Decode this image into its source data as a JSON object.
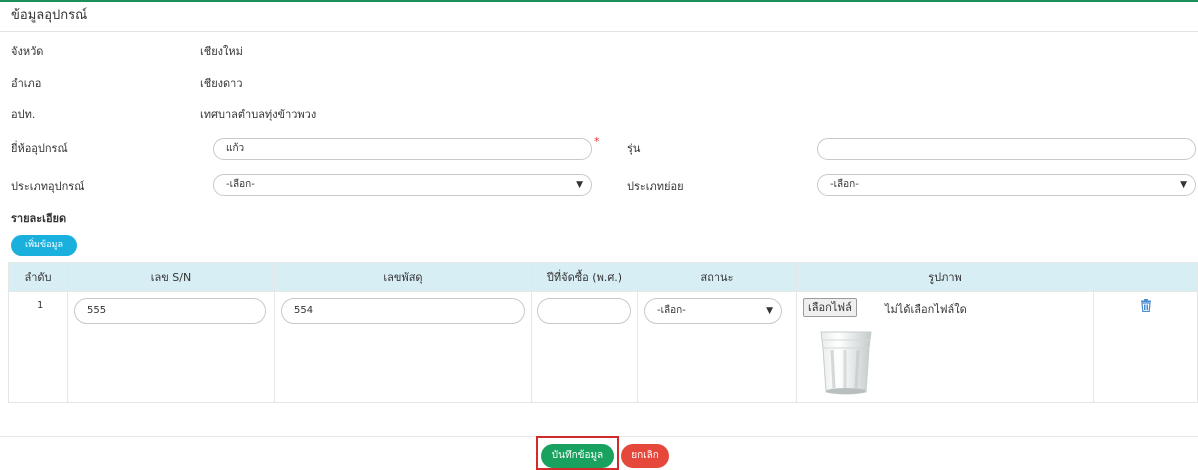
{
  "header": {
    "title": "ข้อมูลอุปกรณ์"
  },
  "info": {
    "province_label": "จังหวัด",
    "province_value": "เชียงใหม่",
    "district_label": "อำเภอ",
    "district_value": "เชียงดาว",
    "org_label": "อปท.",
    "org_value": "เทศบาลตำบลทุ่งข้าวพวง"
  },
  "form": {
    "brand_label": "ยี่ห้ออุปกรณ์",
    "brand_value": "แก้ว",
    "required_mark": "*",
    "model_label": "รุ่น",
    "model_value": "",
    "type_label": "ประเภทอุปกรณ์",
    "type_selected": "-เลือก-",
    "subtype_label": "ประเภทย่อย",
    "subtype_selected": "-เลือก-"
  },
  "details": {
    "title": "รายละเอียด",
    "add_label": "เพิ่มข้อมูล",
    "columns": [
      "ลำดับ",
      "เลข S/N",
      "เลขพัสดุ",
      "ปีที่จัดซื้อ (พ.ศ.)",
      "สถานะ",
      "รูปภาพ",
      ""
    ],
    "rows": [
      {
        "index": "1",
        "serial": "555",
        "parcel": "554",
        "year": "",
        "status": "-เลือก-",
        "file_button": "เลือกไฟล์",
        "file_status": "ไม่ได้เลือกไฟล์ใด"
      }
    ]
  },
  "actions": {
    "save_label": "บันทึกข้อมูล",
    "cancel_label": "ยกเลิก"
  },
  "icons": {
    "delete": "trash-icon",
    "image": "glass-photo"
  },
  "colors": {
    "save": "#19a15f",
    "cancel": "#e5483b",
    "add": "#1ab0de",
    "header_row": "#d8eef5",
    "accent_top": "#1f8f5a"
  }
}
